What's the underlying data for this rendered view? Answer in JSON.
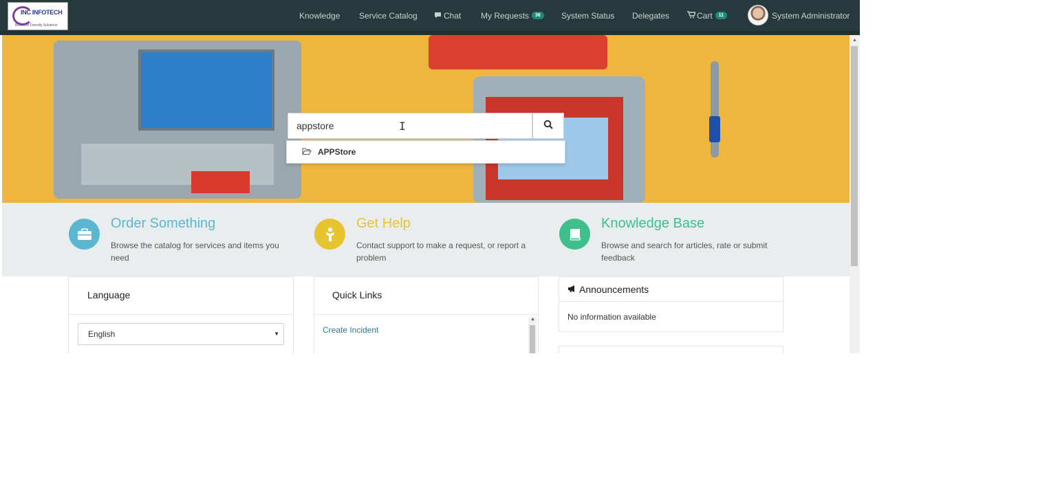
{
  "header": {
    "logo_text": "INC INFOTECH",
    "logo_tagline": "Business Friendly Solutions",
    "nav": {
      "knowledge": "Knowledge",
      "service_catalog": "Service Catalog",
      "chat": "Chat",
      "my_requests": "My Requests",
      "my_requests_count": "36",
      "system_status": "System Status",
      "delegates": "Delegates",
      "cart": "Cart",
      "cart_count": "11",
      "user_name": "System Administrator"
    }
  },
  "search": {
    "value": "appstore",
    "suggestions": [
      "APPStore"
    ]
  },
  "features": [
    {
      "title": "Order Something",
      "desc": "Browse the catalog for services and items you need",
      "color": "#5bb7cf",
      "icon": "briefcase-icon"
    },
    {
      "title": "Get Help",
      "desc": "Contact support to make a request, or report a problem",
      "color": "#e8c42f",
      "icon": "person-help-icon"
    },
    {
      "title": "Knowledge Base",
      "desc": "Browse and search for articles, rate or submit feedback",
      "color": "#3fbf8c",
      "icon": "book-icon"
    }
  ],
  "language_card": {
    "title": "Language",
    "selected": "English"
  },
  "quick_links": {
    "title": "Quick Links",
    "items": [
      "Create Incident"
    ]
  },
  "announcements": {
    "title": "Announcements",
    "empty_text": "No information available"
  },
  "colors": {
    "header_bg": "#263a3d",
    "hero_bg": "#efb63d",
    "link": "#2c7a8c",
    "badge": "#1f8a78"
  }
}
